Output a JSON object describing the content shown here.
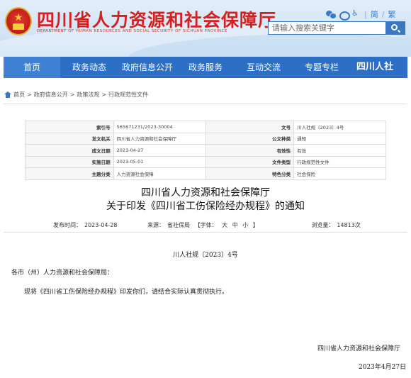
{
  "header": {
    "site_title": "四川省人力资源和社会保障厅",
    "site_title_en": "DEPARTMENT OF HUMAN RESOURCES AND SOCIAL SECURITY OF SICHUAN PROVINCE",
    "top_links": {
      "simplified": "简",
      "traditional": "繁"
    },
    "search_placeholder": "请输入搜索关键字"
  },
  "nav": {
    "items": [
      "首页",
      "政务动态",
      "政府信息公开",
      "政务服务",
      "互动交流",
      "专题专栏"
    ],
    "brand": "四川人社"
  },
  "breadcrumb": [
    "首页",
    "政府信息公开",
    "政策法规",
    "行政规范性文件"
  ],
  "meta": [
    {
      "label1": "索引号",
      "value1": "565671231/2023-30004",
      "label2": "文号",
      "value2": "川人社规〔2023〕4号"
    },
    {
      "label1": "发文机关",
      "value1": "四川省人力资源和社会保障厅",
      "label2": "公文种类",
      "value2": "通知"
    },
    {
      "label1": "成文日期",
      "value1": "2023-04-27",
      "label2": "有效性",
      "value2": "有效"
    },
    {
      "label1": "实施日期",
      "value1": "2023-05-01",
      "label2": "文件类型",
      "value2": "行政规范性文件"
    },
    {
      "label1": "主题分类",
      "value1": "人力资源社会保障",
      "label2": "特色分类",
      "value2": "社会保险"
    }
  ],
  "doc": {
    "title_line1": "四川省人力资源和社会保障厅",
    "title_line2": "关于印发《四川省工伤保险经办规程》的通知",
    "publish_label": "发布时间：",
    "publish_date": "2023-04-28",
    "source_label": "来源：",
    "source": "省社保局",
    "font_label": "【字体：",
    "font_big": "大",
    "font_mid": "中",
    "font_small": "小",
    "font_end": "】",
    "views_label": "浏览量：",
    "views": "14813次",
    "doc_number": "川人社规〔2023〕4号",
    "addressee": "各市（州）人力资源和社会保障局：",
    "body": "现将《四川省工伤保险经办规程》印发你们，请结合实际认真贯彻执行。",
    "signer": "四川省人力资源和社会保障厅",
    "date": "2023年4月27日"
  }
}
